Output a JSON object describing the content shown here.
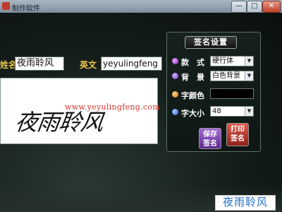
{
  "window": {
    "title": "制作软件",
    "minimize": "—",
    "maximize": "□",
    "close": "✕"
  },
  "form": {
    "name_label": "姓名",
    "name_value": "夜雨聆风",
    "english_label": "英文",
    "english_value": "yeyulingfeng"
  },
  "preview": {
    "url_watermark": "www.yeyulingfeng.com",
    "signature_text": "夜雨聆风"
  },
  "settings": {
    "title": "签名设置",
    "style_label": "款　式",
    "style_value": "硬行体",
    "background_label": "背　景",
    "background_value": "白色背景",
    "font_color_label": "字颜色",
    "font_color_value": "#000000",
    "font_size_label": "字大小",
    "font_size_value": "48",
    "save_button": "保存签名",
    "print_button": "打印签名"
  },
  "brand": {
    "text": "夜雨聆风"
  },
  "icons": {
    "dropdown": "▼"
  }
}
